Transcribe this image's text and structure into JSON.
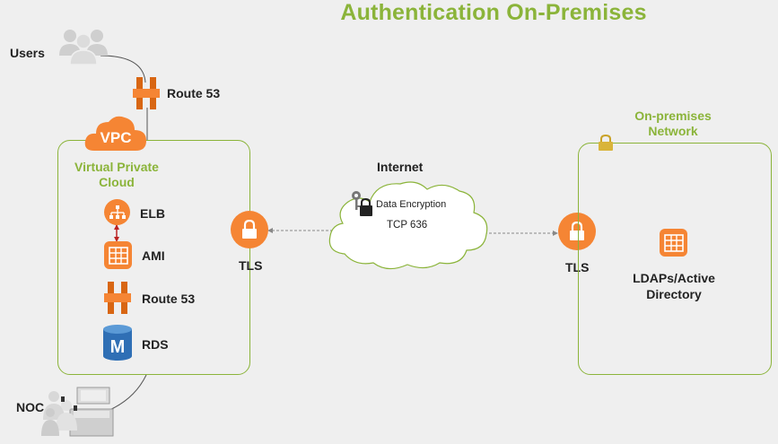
{
  "title": "Authentication On-Premises",
  "users": {
    "label": "Users"
  },
  "route53_top": {
    "label": "Route 53"
  },
  "vpc": {
    "badge": "VPC",
    "title": "Virtual Private Cloud",
    "services": [
      {
        "label": "ELB",
        "icon": "elb-icon"
      },
      {
        "label": "AMI",
        "icon": "ami-icon"
      },
      {
        "label": "Route 53",
        "icon": "route53-icon"
      },
      {
        "label": "RDS",
        "icon": "rds-icon"
      }
    ]
  },
  "tls_left": {
    "label": "TLS"
  },
  "internet": {
    "label": "Internet",
    "line1": "Data Encryption",
    "line2": "TCP 636"
  },
  "tls_right": {
    "label": "TLS"
  },
  "onprem": {
    "title": "On-premises Network",
    "service": "LDAPs/Active Directory"
  },
  "noc": {
    "label": "NOC"
  },
  "colors": {
    "accent": "#8bb43a",
    "aws_orange": "#f58534",
    "rds_blue": "#2f6fb5"
  }
}
